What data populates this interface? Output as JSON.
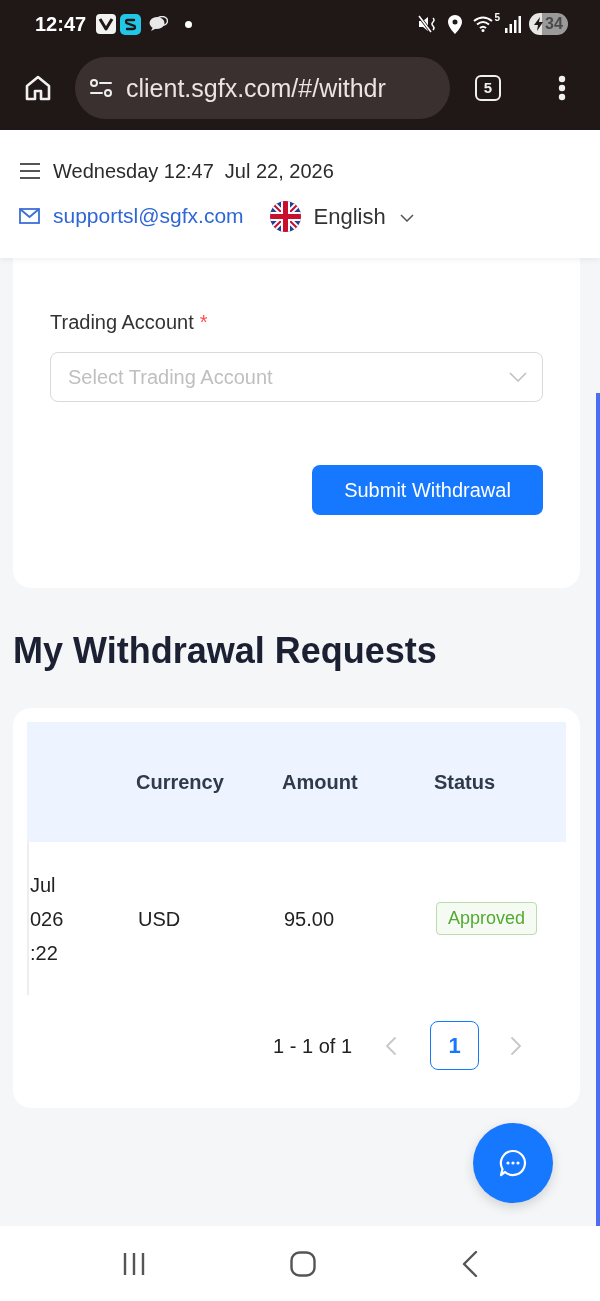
{
  "status_bar": {
    "time": "12:47",
    "wifi_label": "5",
    "battery": "34"
  },
  "browser": {
    "url": "client.sgfx.com/#/withdr",
    "tab_count": "5"
  },
  "header": {
    "day_time": "Wednesday 12:47",
    "date": "Jul 22, 2026",
    "email": "supportsl@sgfx.com",
    "language": "English"
  },
  "withdrawal_form": {
    "fields": [
      {
        "label": "Trading Account",
        "required_mark": "*",
        "placeholder": "Select Trading Account"
      }
    ],
    "submit_button": "Submit Withdrawal"
  },
  "requests": {
    "title": "My Withdrawal Requests",
    "table": {
      "columns": [
        "Currency",
        "Amount",
        "Status"
      ],
      "rows": [
        {
          "column_1": [
            "Jul",
            "026",
            ":22"
          ],
          "currency": "USD",
          "amount": "95.00",
          "status": {
            "label": "Approved",
            "color": "#52aa32"
          }
        }
      ]
    },
    "pagination": {
      "summary": "1 - 1 of 1",
      "prev_disabled": true,
      "pages": [
        {
          "label": "1",
          "selected": true
        }
      ],
      "next_disabled": true
    }
  }
}
